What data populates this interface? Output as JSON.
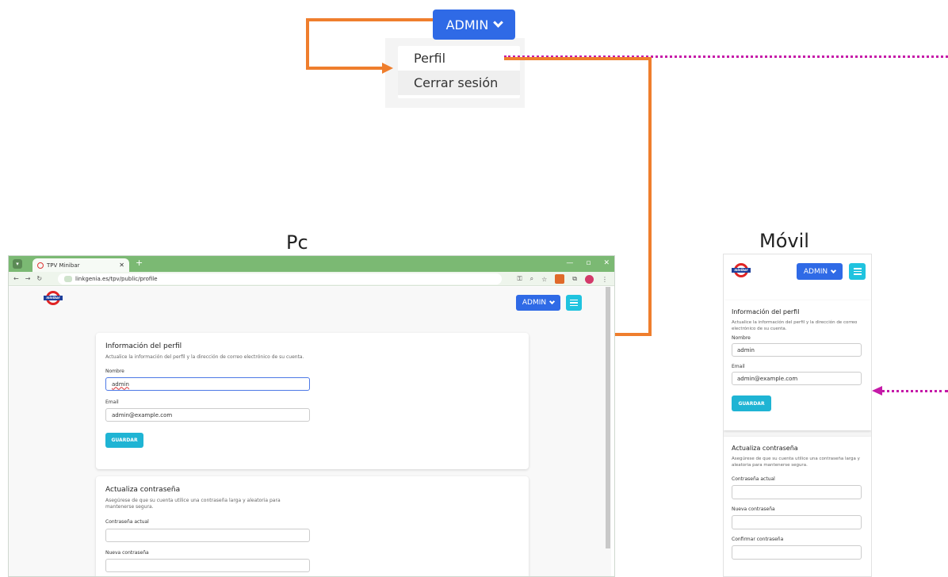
{
  "dropdown": {
    "admin_label": "ADMIN",
    "items": [
      "Perfil",
      "Cerrar sesión"
    ]
  },
  "captions": {
    "pc": "Pc",
    "mobile": "Móvil"
  },
  "browser": {
    "tab_title": "TPV Minibar",
    "url": "linkgenia.es/tpv/public/profile"
  },
  "app": {
    "admin_label": "ADMIN",
    "logo_text": "minibar"
  },
  "profile": {
    "title": "Información del perfil",
    "desc": "Actualice la información del perfil y la dirección de correo electrónico de su cuenta.",
    "name_label": "Nombre",
    "name_value": "admin",
    "email_label": "Email",
    "email_value": "admin@example.com",
    "save_label": "GUARDAR"
  },
  "password": {
    "title": "Actualiza contraseña",
    "desc": "Asegúrese de que su cuenta utilice una contraseña larga y aleatoria para mantenerse segura.",
    "current_label": "Contraseña actual",
    "new_label": "Nueva contraseña",
    "confirm_label": "Confirmar contraseña"
  },
  "colors": {
    "annotation_orange": "#ef7e2d",
    "annotation_magenta": "#c51aa8",
    "admin_blue": "#2f6ae6",
    "save_cyan": "#1fb4d4"
  }
}
